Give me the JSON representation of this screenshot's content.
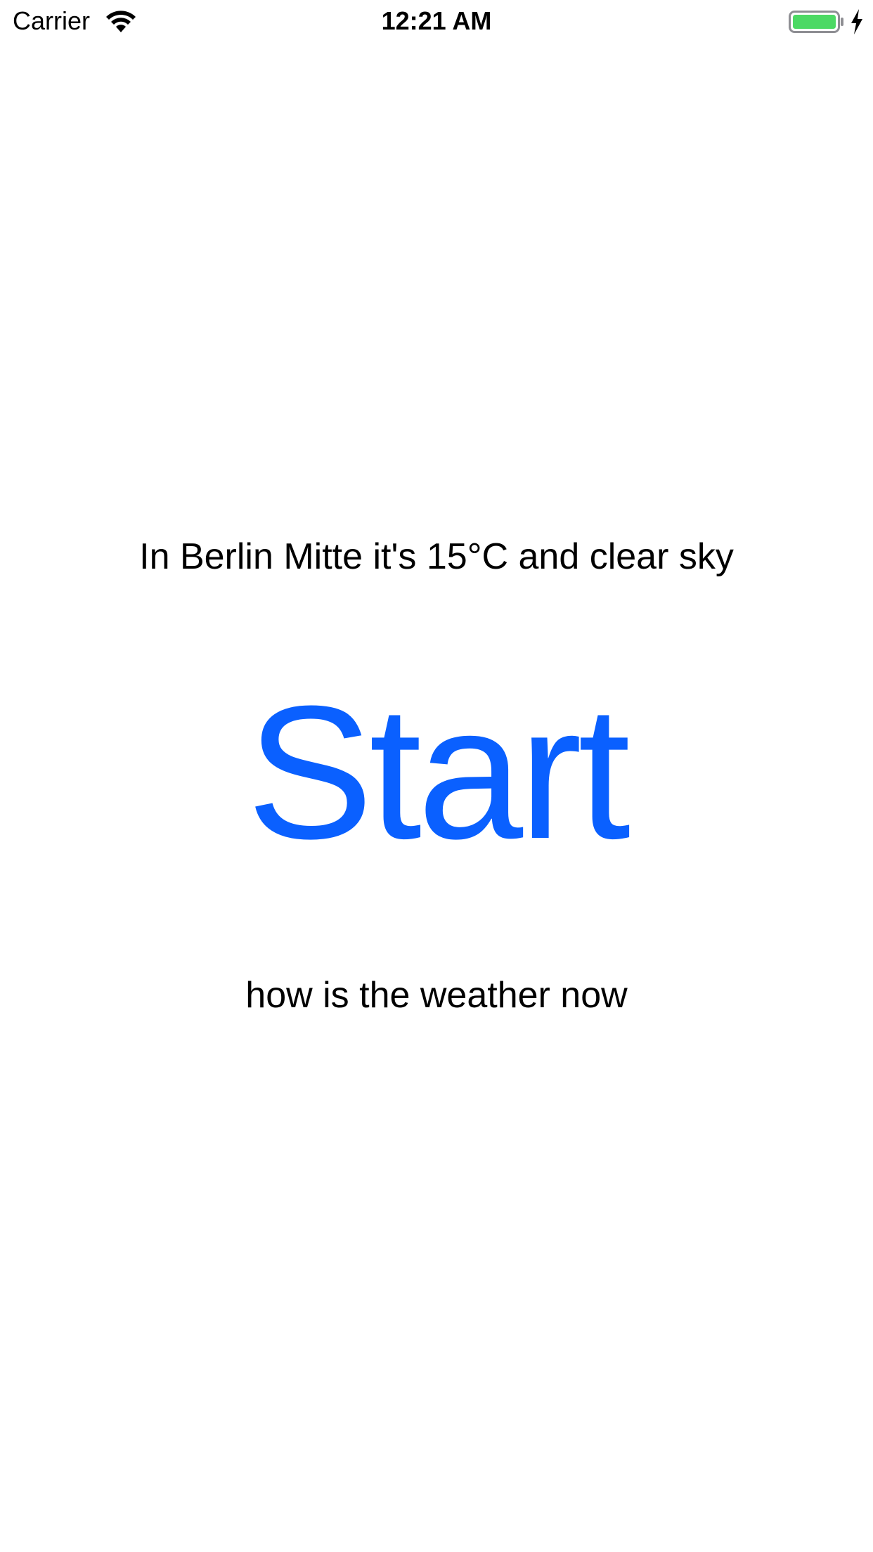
{
  "status_bar": {
    "carrier": "Carrier",
    "time": "12:21 AM",
    "wifi_icon": "wifi-icon",
    "battery_icon": "battery-icon",
    "charging_icon": "charging-bolt-icon",
    "battery_level": 1.0,
    "battery_color": "#4cd964"
  },
  "main": {
    "weather_text": "In Berlin Mitte it's 15°C and clear sky",
    "start_label": "Start",
    "subtitle": "how is the weather now"
  },
  "colors": {
    "accent": "#0a60ff",
    "text": "#000000",
    "background": "#ffffff"
  }
}
